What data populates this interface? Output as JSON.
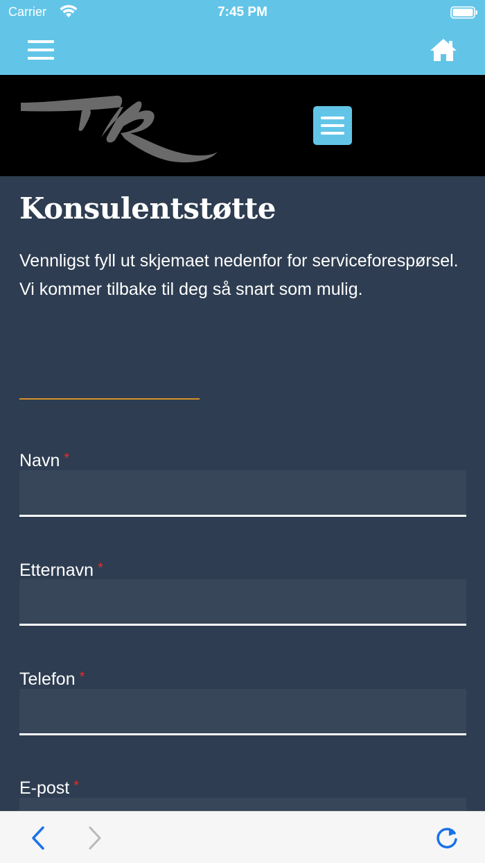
{
  "status": {
    "carrier": "Carrier",
    "time": "7:45 PM"
  },
  "icons": {
    "nav_menu": "hamburger-menu-icon",
    "nav_home": "home-icon",
    "site_menu": "hamburger-menu-icon",
    "back": "chevron-left-icon",
    "forward": "chevron-right-icon",
    "reload": "reload-icon"
  },
  "colors": {
    "bar": "#62c5e8",
    "page_bg": "#2e3d51",
    "input_bg": "#374659",
    "divider": "#d4922a",
    "required": "#e0302b",
    "toolbar_accent": "#1a73e8"
  },
  "page": {
    "title": "Konsulentstøtte",
    "intro": "Vennligst fyll ut skjemaet nedenfor for serviceforespørsel. Vi kommer tilbake til deg så snart som mulig."
  },
  "form": {
    "required_mark": "*",
    "fields": [
      {
        "label": "Navn",
        "value": ""
      },
      {
        "label": "Etternavn",
        "value": ""
      },
      {
        "label": "Telefon",
        "value": ""
      },
      {
        "label": "E-post",
        "value": ""
      }
    ]
  }
}
